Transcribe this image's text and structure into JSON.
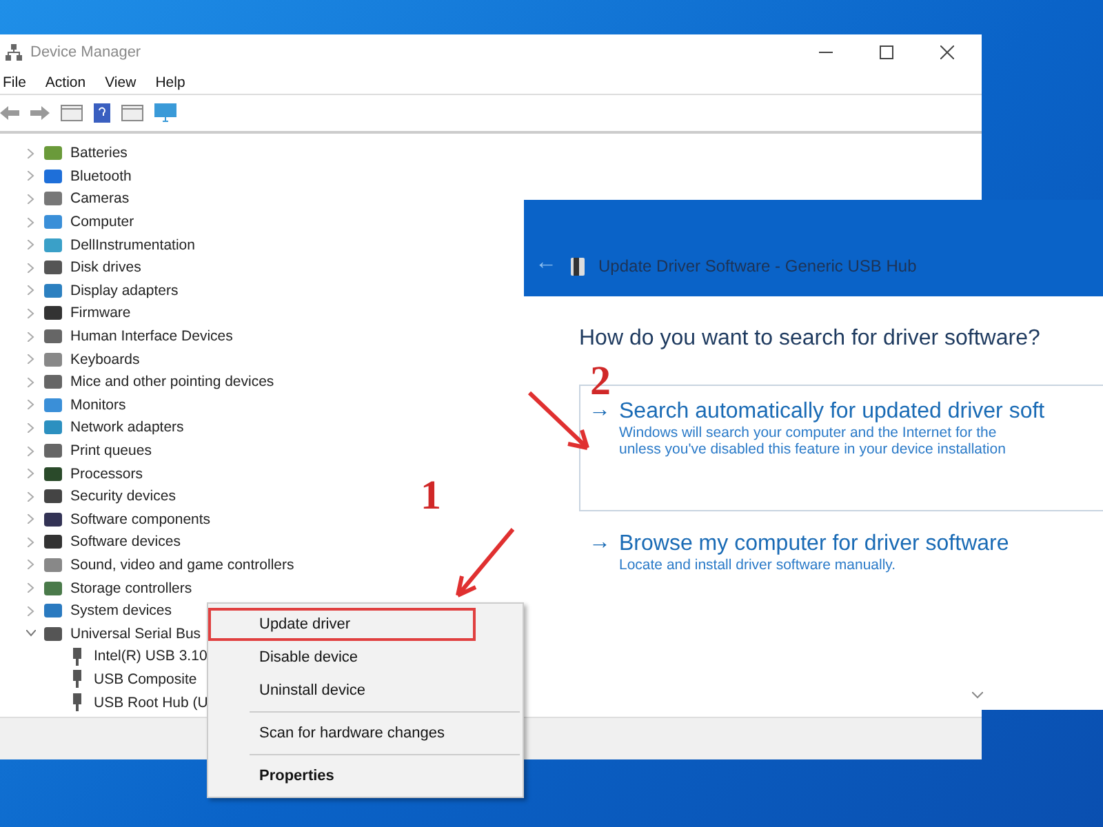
{
  "window": {
    "title": "Device Manager",
    "menu": [
      "File",
      "Action",
      "View",
      "Help"
    ]
  },
  "tree": [
    {
      "label": "Batteries",
      "expanded": false
    },
    {
      "label": "Bluetooth",
      "expanded": false
    },
    {
      "label": "Cameras",
      "expanded": false
    },
    {
      "label": "Computer",
      "expanded": false
    },
    {
      "label": "DellInstrumentation",
      "expanded": false
    },
    {
      "label": "Disk drives",
      "expanded": false
    },
    {
      "label": "Display adapters",
      "expanded": false
    },
    {
      "label": "Firmware",
      "expanded": false
    },
    {
      "label": "Human Interface Devices",
      "expanded": false
    },
    {
      "label": "Keyboards",
      "expanded": false
    },
    {
      "label": "Mice and other pointing devices",
      "expanded": false
    },
    {
      "label": "Monitors",
      "expanded": false
    },
    {
      "label": "Network adapters",
      "expanded": false
    },
    {
      "label": "Print queues",
      "expanded": false
    },
    {
      "label": "Processors",
      "expanded": false
    },
    {
      "label": "Security devices",
      "expanded": false
    },
    {
      "label": "Software components",
      "expanded": false
    },
    {
      "label": "Software devices",
      "expanded": false
    },
    {
      "label": "Sound, video and game controllers",
      "expanded": false
    },
    {
      "label": "Storage controllers",
      "expanded": false
    },
    {
      "label": "System devices",
      "expanded": false
    },
    {
      "label": "Universal Serial Bus",
      "expanded": true,
      "children": [
        {
          "label": "Intel(R) USB 3.10"
        },
        {
          "label": "USB Composite"
        },
        {
          "label": "USB Root Hub (U"
        }
      ]
    }
  ],
  "context_menu": [
    {
      "label": "Update driver",
      "bold": false,
      "highlighted": true,
      "separator_before": false
    },
    {
      "label": "Disable device",
      "bold": false,
      "highlighted": false,
      "separator_before": false
    },
    {
      "label": "Uninstall device",
      "bold": false,
      "highlighted": false,
      "separator_before": false
    },
    {
      "label": "Scan for hardware changes",
      "bold": false,
      "highlighted": false,
      "separator_before": true
    },
    {
      "label": "Properties",
      "bold": true,
      "highlighted": false,
      "separator_before": true
    }
  ],
  "dialog": {
    "back": "←",
    "title": "Update Driver Software - Generic USB Hub",
    "heading": "How do you want to search for driver software?",
    "options": [
      {
        "arrow": "→",
        "title": "Search automatically for updated driver soft",
        "lines": [
          "Windows will search your computer and the Internet for the",
          "unless you've disabled this feature in your device installation"
        ],
        "selected": true
      },
      {
        "arrow": "→",
        "title": "Browse my computer for driver software",
        "lines": [
          "Locate and install driver software manually."
        ],
        "selected": false
      }
    ]
  },
  "annotations": [
    {
      "label": "1"
    },
    {
      "label": "2"
    }
  ]
}
